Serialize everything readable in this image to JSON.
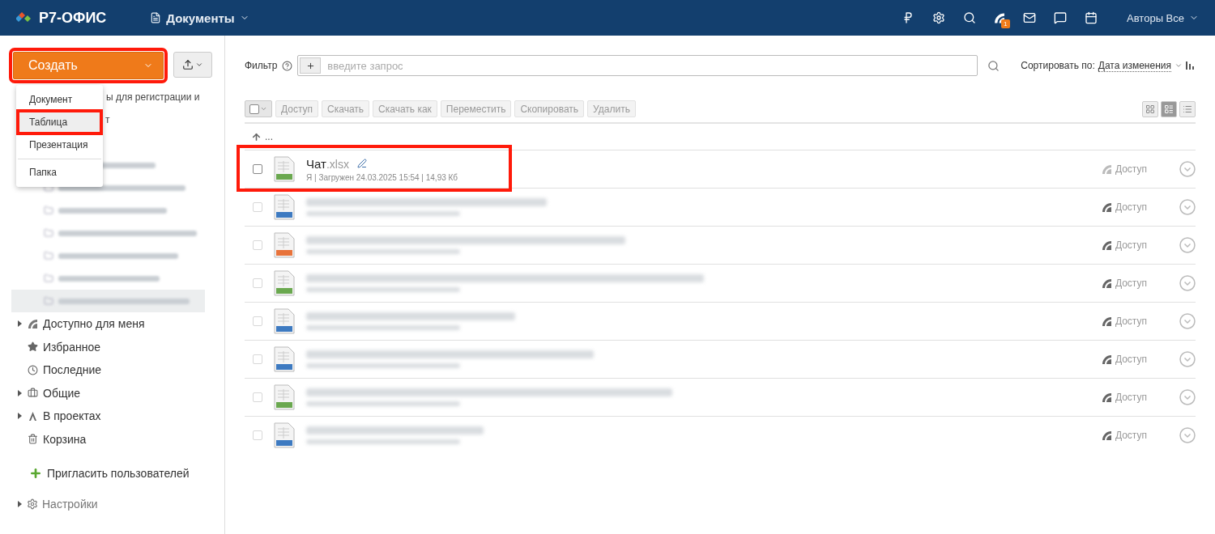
{
  "header": {
    "logo": "Р7-ОФИС",
    "module": "Документы",
    "notifications_badge": "1",
    "user": "Авторы Все"
  },
  "sidebar": {
    "create_button": {
      "label": "Создать",
      "highlighted": true
    },
    "create_menu": [
      {
        "label": "Документ",
        "highlighted": false
      },
      {
        "label": "Таблица",
        "highlighted": true
      },
      {
        "label": "Презентация",
        "highlighted": false
      },
      {
        "label": "Папка",
        "highlighted": false
      }
    ],
    "partial_texts": [
      "ы для регистрации и",
      "т"
    ],
    "blurred_folders": [
      {
        "selected": false
      },
      {
        "selected": false
      },
      {
        "selected": false
      },
      {
        "selected": false
      },
      {
        "selected": false
      },
      {
        "selected": false
      },
      {
        "selected": true
      }
    ],
    "nav": [
      {
        "kind": "shared",
        "label": "Доступно для меня",
        "expandable": true
      },
      {
        "kind": "favorites",
        "label": "Избранное",
        "expandable": false
      },
      {
        "kind": "recent",
        "label": "Последние",
        "expandable": false
      },
      {
        "kind": "common",
        "label": "Общие",
        "expandable": true
      },
      {
        "kind": "projects",
        "label": "В проектах",
        "expandable": true
      },
      {
        "kind": "trash",
        "label": "Корзина",
        "expandable": false
      }
    ],
    "invite": "Пригласить пользователей",
    "settings": "Настройки"
  },
  "filter": {
    "label": "Фильтр",
    "placeholder": "введите запрос",
    "sort_label": "Сортировать по:",
    "sort_value": "Дата изменения"
  },
  "toolbar": [
    "Доступ",
    "Скачать",
    "Скачать как",
    "Переместить",
    "Скопировать",
    "Удалить"
  ],
  "view_modes": [
    {
      "kind": "tiles",
      "selected": false
    },
    {
      "kind": "compact",
      "selected": true
    },
    {
      "kind": "list",
      "selected": false
    }
  ],
  "up_link": "...",
  "files": [
    {
      "blurred": false,
      "checked": false,
      "highlighted": true,
      "name": "Чат",
      "ext": ".xlsx",
      "meta": "Я | Загружен 24.03.2025 15:54 | 14,93 Кб",
      "color": "#6aa84f",
      "share": "Доступ"
    },
    {
      "blurred": true,
      "checked": false,
      "highlighted": false,
      "color": "#3d7ac1",
      "share": "Доступ"
    },
    {
      "blurred": true,
      "checked": false,
      "highlighted": false,
      "color": "#e8733b",
      "share": "Доступ"
    },
    {
      "blurred": true,
      "checked": false,
      "highlighted": false,
      "color": "#6aa84f",
      "share": "Доступ"
    },
    {
      "blurred": true,
      "checked": false,
      "highlighted": false,
      "color": "#3d7ac1",
      "share": "Доступ"
    },
    {
      "blurred": true,
      "checked": false,
      "highlighted": false,
      "color": "#3d7ac1",
      "share": "Доступ"
    },
    {
      "blurred": true,
      "checked": false,
      "highlighted": false,
      "color": "#6aa84f",
      "share": "Доступ"
    },
    {
      "blurred": true,
      "checked": false,
      "highlighted": false,
      "color": "#3d7ac1",
      "share": "Доступ"
    }
  ]
}
